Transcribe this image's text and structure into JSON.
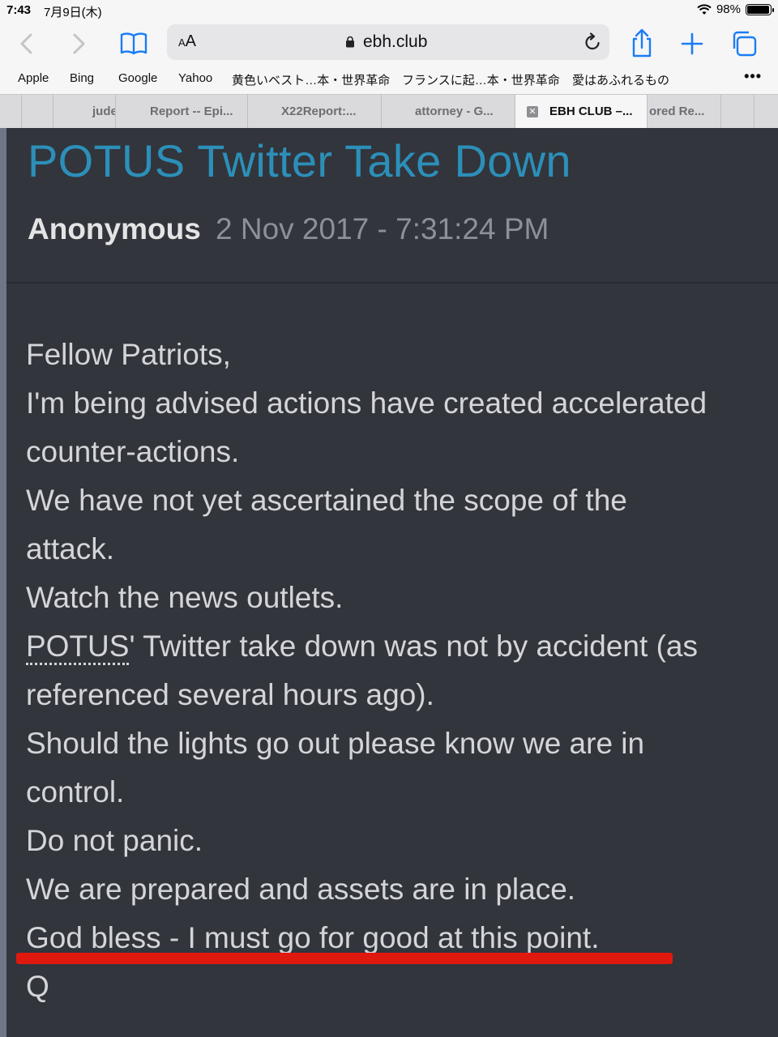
{
  "status_bar": {
    "time": "7:43",
    "date": "7月9日(木)",
    "battery": "98%"
  },
  "toolbar": {
    "aa_small": "A",
    "aa_large": "A",
    "url": "ebh.club"
  },
  "favorites": [
    "Apple",
    "Bing",
    "Google",
    "Yahoo",
    "黄色いベスト…本・世界革命",
    "フランスに起…本・世界革命",
    "愛はあふれるもの"
  ],
  "favorites_more": "•••",
  "tabs": [
    "jude",
    "Report -- Epi...",
    "X22Report:...",
    "attorney - G...",
    "EBH CLUB –...",
    "ored Re..."
  ],
  "tab_close": "✕",
  "post": {
    "title": "POTUS Twitter Take Down",
    "author": "Anonymous",
    "timestamp": "2 Nov 2017 - 7:31:24 PM",
    "lines": [
      "Fellow Patriots,",
      "I'm being advised actions have created accelerated",
      "counter-actions.",
      "We have not yet ascertained the scope of the",
      "attack.",
      "Watch the news outlets.",
      "POTUS",
      "' Twitter take down was not by accident (as",
      "referenced several hours ago).",
      "Should the lights go out please know we are in",
      "control.",
      "Do not panic.",
      "We are prepared and assets are in place.",
      "God bless - I must go for good at this point.",
      "Q"
    ]
  },
  "colors": {
    "title": "#2c8fb9",
    "background": "#32353c",
    "highlight_underline": "#e0190e"
  },
  "icons": [
    "back-icon",
    "forward-icon",
    "bookmarks-icon",
    "lock-icon",
    "reload-icon",
    "share-icon",
    "plus-icon",
    "tabs-icon",
    "wifi-icon",
    "battery-icon"
  ]
}
